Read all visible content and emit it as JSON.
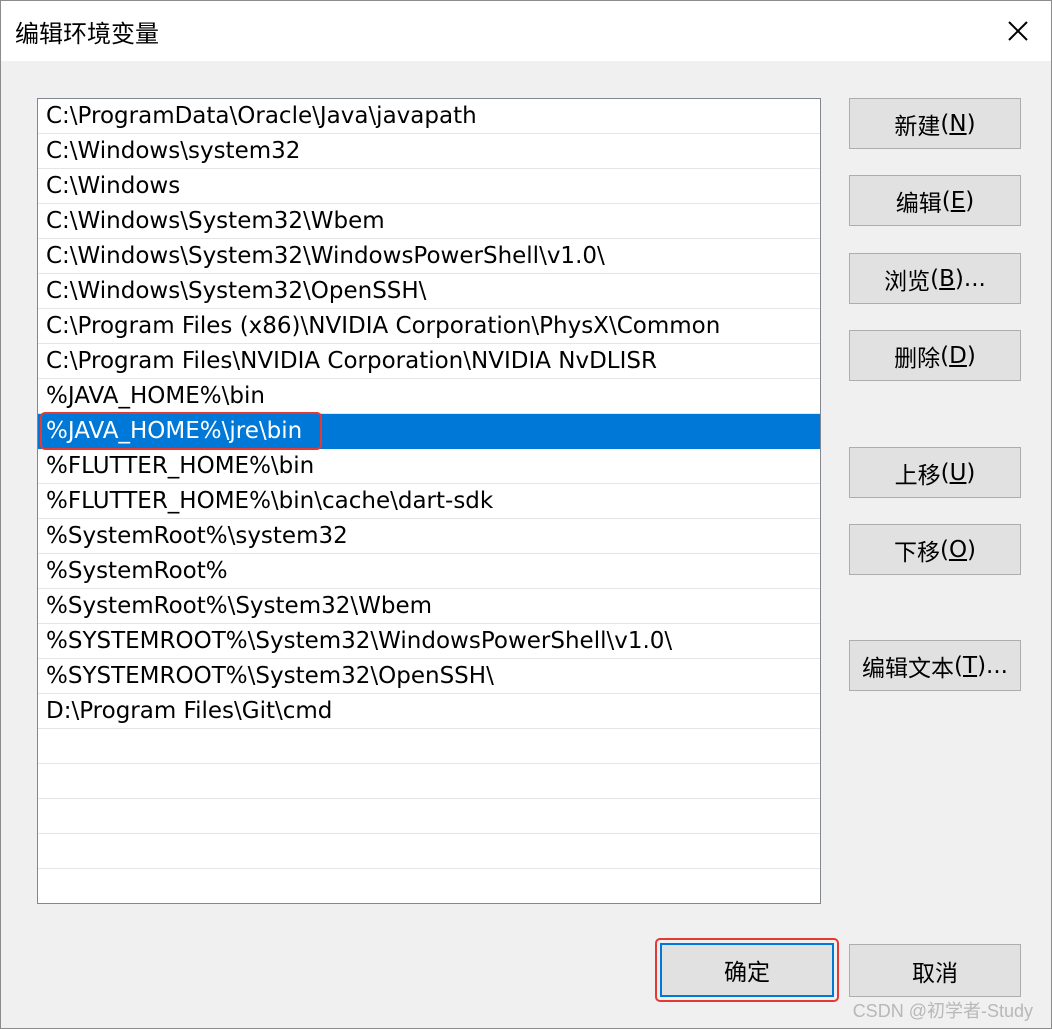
{
  "window": {
    "title": "编辑环境变量"
  },
  "paths": [
    "C:\\ProgramData\\Oracle\\Java\\javapath",
    "C:\\Windows\\system32",
    "C:\\Windows",
    "C:\\Windows\\System32\\Wbem",
    "C:\\Windows\\System32\\WindowsPowerShell\\v1.0\\",
    "C:\\Windows\\System32\\OpenSSH\\",
    "C:\\Program Files (x86)\\NVIDIA Corporation\\PhysX\\Common",
    "C:\\Program Files\\NVIDIA Corporation\\NVIDIA NvDLISR",
    "%JAVA_HOME%\\bin",
    "%JAVA_HOME%\\jre\\bin",
    "%FLUTTER_HOME%\\bin",
    "%FLUTTER_HOME%\\bin\\cache\\dart-sdk",
    "%SystemRoot%\\system32",
    "%SystemRoot%",
    "%SystemRoot%\\System32\\Wbem",
    "%SYSTEMROOT%\\System32\\WindowsPowerShell\\v1.0\\",
    "%SYSTEMROOT%\\System32\\OpenSSH\\",
    "D:\\Program Files\\Git\\cmd"
  ],
  "selected_path": "%JAVA_HOME%\\jre\\bin",
  "buttons": {
    "new": {
      "label": "新建",
      "key": "N",
      "suffix": ""
    },
    "edit": {
      "label": "编辑",
      "key": "E",
      "suffix": ""
    },
    "browse": {
      "label": "浏览",
      "key": "B",
      "suffix": "..."
    },
    "delete": {
      "label": "删除",
      "key": "D",
      "suffix": ""
    },
    "move_up": {
      "label": "上移",
      "key": "U",
      "suffix": ""
    },
    "move_down": {
      "label": "下移",
      "key": "O",
      "suffix": ""
    },
    "edit_text": {
      "label": "编辑文本",
      "key": "T",
      "suffix": "..."
    },
    "ok": "确定",
    "cancel": "取消"
  },
  "watermark": "CSDN @初学者-Study",
  "colors": {
    "selection": "#0078d7",
    "annotation": "#e53935"
  }
}
